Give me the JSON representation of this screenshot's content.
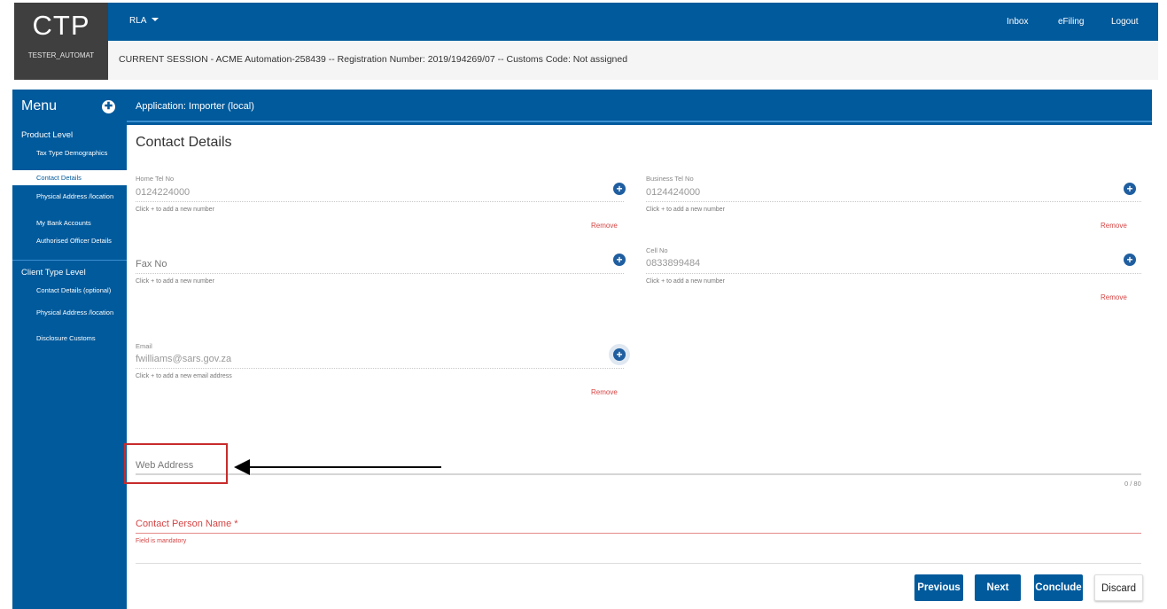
{
  "brand": {
    "logo": "CTP",
    "user": "TESTER_AUTOMAT"
  },
  "topbar": {
    "selector_label": "RLA",
    "links": [
      "Inbox",
      "eFiling",
      "Logout"
    ]
  },
  "session": {
    "text": "CURRENT SESSION - ACME Automation-258439 -- Registration Number: 2019/194269/07 -- Customs Code: Not assigned"
  },
  "menu": {
    "title": "Menu"
  },
  "application": {
    "title": "Application: Importer (local)"
  },
  "sidebar": {
    "product_level": {
      "heading": "Product Level",
      "items": [
        {
          "label": "Tax Type Demographics",
          "active": false
        },
        {
          "label": "Contact Details",
          "active": true
        },
        {
          "label": "Physical Address /location",
          "active": false
        },
        {
          "label": "My Bank Accounts",
          "active": false
        },
        {
          "label": "Authorised Officer Details",
          "active": false
        }
      ]
    },
    "client_type_level": {
      "heading": "Client Type Level",
      "items": [
        {
          "label": "Contact Details (optional)"
        },
        {
          "label": "Physical Address /location"
        },
        {
          "label": "Disclosure Customs"
        }
      ]
    }
  },
  "form": {
    "title": "Contact Details",
    "home_tel": {
      "label": "Home Tel No",
      "value": "0124224000",
      "hint": "Click + to add a new number",
      "remove": "Remove"
    },
    "business_tel": {
      "label": "Business Tel No",
      "value": "0124424000",
      "hint": "Click + to add a new number",
      "remove": "Remove"
    },
    "fax": {
      "placeholder": "Fax No",
      "hint": "Click + to add a new number"
    },
    "cell": {
      "label": "Cell No",
      "value": "0833899484",
      "hint": "Click + to add a new number",
      "remove": "Remove"
    },
    "email": {
      "label": "Email",
      "value": "fwilliams@sars.gov.za",
      "hint": "Click + to add a new email address",
      "remove": "Remove"
    },
    "web_address": {
      "placeholder": "Web Address",
      "counter": "0 / 80"
    },
    "contact_person": {
      "placeholder": "Contact Person Name *",
      "error": "Field is mandatory"
    }
  },
  "buttons": {
    "previous": "Previous",
    "next": "Next",
    "conclude": "Conclude",
    "discard": "Discard"
  },
  "colors": {
    "primary": "#005a9c",
    "header_dark": "#3f3f3f",
    "error": "#d64545",
    "annotation": "#c72c2c"
  }
}
